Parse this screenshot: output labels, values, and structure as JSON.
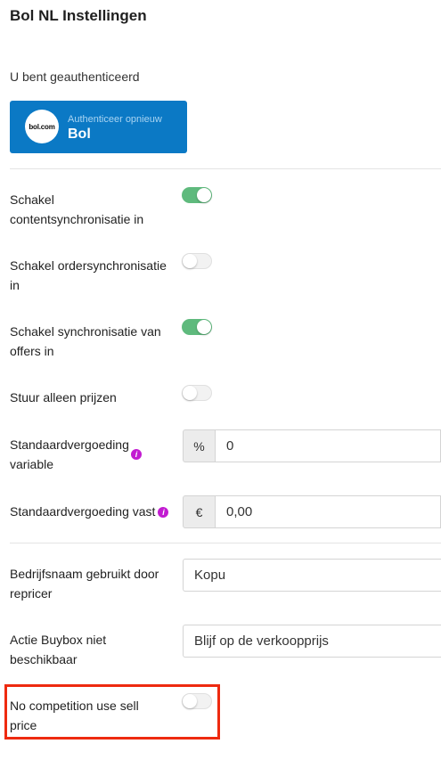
{
  "header": {
    "title": "Bol NL Instellingen"
  },
  "auth": {
    "status_text": "U bent geauthenticeerd",
    "button_small": "Authenticeer opnieuw",
    "button_big": "Bol",
    "logo_text": "bol.com"
  },
  "settings": {
    "content_sync": {
      "label": "Schakel contentsynchronisatie in",
      "enabled": true
    },
    "order_sync": {
      "label": "Schakel ordersynchronisatie in",
      "enabled": false
    },
    "offers_sync": {
      "label": "Schakel synchronisatie van offers in",
      "enabled": true
    },
    "prices_only": {
      "label": "Stuur alleen prijzen",
      "enabled": false
    },
    "variable_fee": {
      "label": "Standaardvergoeding variable",
      "addon": "%",
      "value": "0"
    },
    "fixed_fee": {
      "label": "Standaardvergoeding vast",
      "addon": "€",
      "value": "0,00"
    },
    "company_name": {
      "label": "Bedrijfsnaam gebruikt door repricer",
      "value": "Kopu"
    },
    "buybox_action": {
      "label": "Actie Buybox niet beschikbaar",
      "value": "Blijf op de verkoopprijs"
    },
    "no_competition": {
      "label": "No competition use sell price",
      "enabled": false
    }
  },
  "colors": {
    "accent_button": "#0b79c5",
    "toggle_on": "#5fba7d",
    "info_icon": "#c21bd1",
    "highlight_border": "#ee2a10"
  },
  "icons": {
    "info": "info-icon",
    "logo": "bol-logo-icon"
  }
}
